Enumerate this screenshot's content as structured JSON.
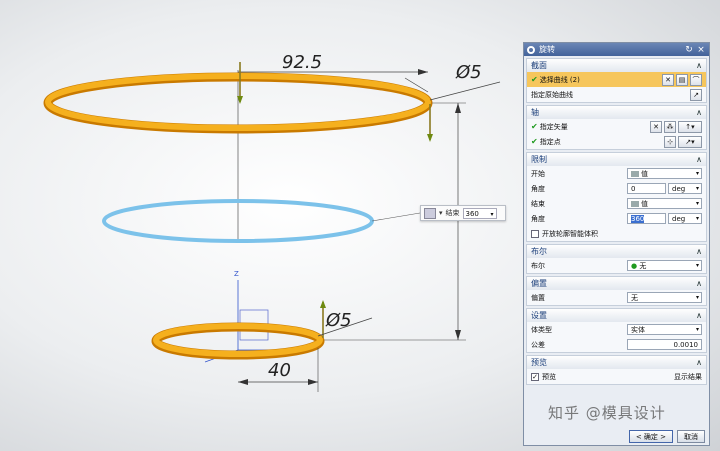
{
  "viewport": {
    "dim_large_diameter": "92.5",
    "dim_large_wire": "Ø5",
    "dim_small_wire": "Ø5",
    "dim_small_length": "40",
    "axis_z_label": "Z",
    "colors": {
      "ring": "#f2a413",
      "ring_dark": "#c97a00",
      "preview_ring": "#7cc2ea",
      "triad": "#3355cc"
    }
  },
  "handle_bar": {
    "end_label": "结束",
    "end_value": "360"
  },
  "dialog": {
    "title": "旋转",
    "sections": {
      "section": {
        "name": "截面",
        "select_curve": "选择曲线 (2)",
        "origin_curve": "指定原始曲线"
      },
      "axis": {
        "name": "轴",
        "vector": "指定矢量",
        "point": "指定点"
      },
      "limits": {
        "name": "限制",
        "start_label": "开始",
        "start_type": "值",
        "start_angle_label": "角度",
        "start_angle": "0",
        "start_unit": "deg",
        "end_label": "结束",
        "end_type": "值",
        "end_angle_label": "角度",
        "end_angle": "360",
        "end_unit": "deg",
        "open_profile": "开放轮廓智能体积"
      },
      "boolean": {
        "name": "布尔",
        "label": "布尔",
        "value": "无"
      },
      "offset": {
        "name": "偏置",
        "label": "偏置",
        "value": "无"
      },
      "settings": {
        "name": "设置",
        "body_type_label": "体类型",
        "body_type": "实体",
        "tolerance_label": "公差",
        "tolerance": "0.0010"
      },
      "preview": {
        "name": "预览",
        "preview_label": "预览",
        "result": "显示结果"
      }
    },
    "ok": "< 确定 >",
    "cancel": "取消"
  },
  "watermark": "知乎 @模具设计"
}
